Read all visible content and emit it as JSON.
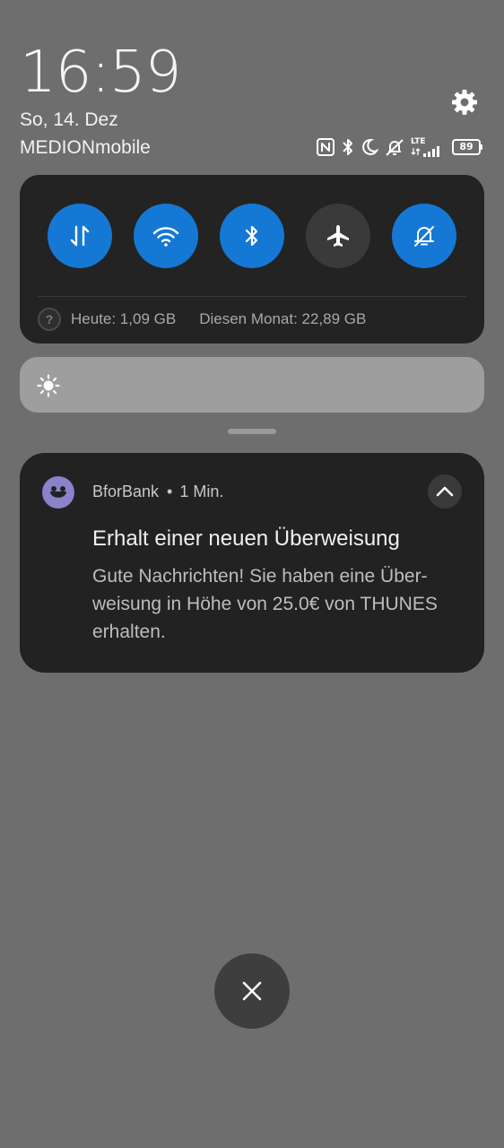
{
  "status_bar": {
    "time": "16:59",
    "date": "So, 14. Dez",
    "carrier": "MEDIONmobile",
    "network_type": "LTE",
    "battery_level": "89",
    "icons": [
      "nfc-icon",
      "bluetooth-icon",
      "moon-icon",
      "vibrate-off-icon",
      "lte-icon",
      "signal-icon",
      "battery-icon"
    ]
  },
  "quick_settings": {
    "tiles": [
      {
        "name": "mobile-data",
        "icon": "data-transfer-icon",
        "state": "on"
      },
      {
        "name": "wifi",
        "icon": "wifi-icon",
        "state": "on"
      },
      {
        "name": "bluetooth",
        "icon": "bluetooth-icon",
        "state": "on"
      },
      {
        "name": "airplane-mode",
        "icon": "airplane-icon",
        "state": "off"
      },
      {
        "name": "silent",
        "icon": "bell-off-icon",
        "state": "on"
      }
    ],
    "data_usage": {
      "today": "Heute: 1,09 GB",
      "month": "Diesen Monat: 22,89 GB"
    },
    "accent_color": "#1578d4"
  },
  "brightness": {
    "icon": "sun-icon"
  },
  "notification": {
    "app_name": "BforBank",
    "separator": "•",
    "time_ago": "1 Min.",
    "title": "Erhalt einer neuen Überweisung",
    "body_lines": [
      "Gute Nachrichten! Sie haben eine Über-",
      "weisung in Höhe von 25.0€ von THUNES",
      "erhalten."
    ],
    "app_icon_color": "#8a83c9"
  },
  "clear_all": {
    "icon": "close-icon"
  }
}
